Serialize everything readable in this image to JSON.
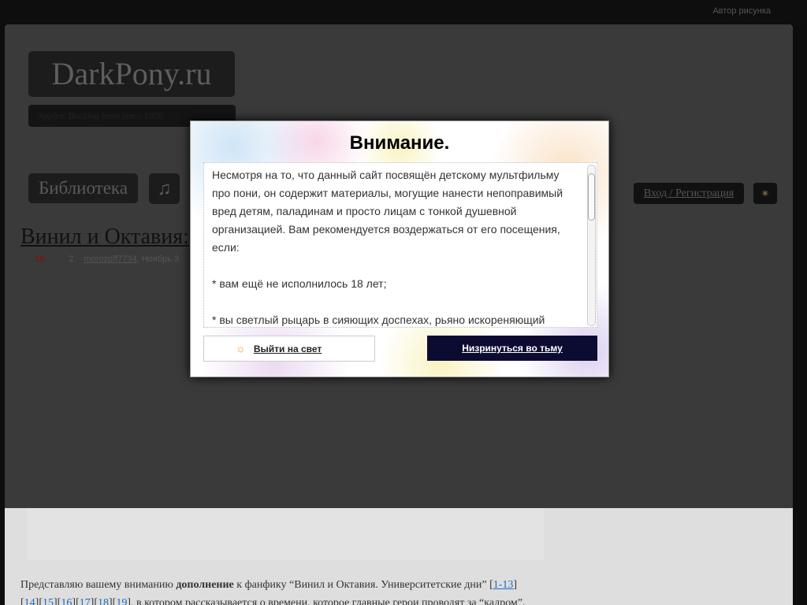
{
  "topbar": {
    "author_link": "Автор рисунка"
  },
  "header": {
    "logo": "DarkPony.ru",
    "tagline": "Apples. Bucking trees since 1976",
    "library": "Библиотека",
    "music_icon": "music-note-icon",
    "login": "Вход / Регистрация",
    "theme_icon": "sun-icon"
  },
  "post": {
    "title": "Винил и Октавия:",
    "age": "18",
    "comments": "2",
    "author": "morozoff7734",
    "date": "Ноябрь 3"
  },
  "intro": {
    "t1": "Представляю вашему вниманию ",
    "bold": "дополнение",
    "t2": " к фанфику “Винил и Октавия. Университетские дни” [",
    "l0": "1-13",
    "t3": "]",
    "l1": "14",
    "l2": "15",
    "l3": "16",
    "l4": "17",
    "l5": "18",
    "l6": "19",
    "t4": ", в котором рассказывается о времени, которое главные герои проводят за “кадром”."
  },
  "modal": {
    "title": "Внимание.",
    "p1": "Несмотря на то, что данный сайт посвящён детскому мультфильму про пони, он содержит материалы, могущие нанести непоправимый вред детям, паладинам и просто лицам с тонкой душевной организацией. Вам рекомендуется воздержаться от его посещения, если:",
    "p2": "* вам ещё не исполнилось 18 лет;",
    "p3": "* вы светлый рыцарь в сияющих доспехах, рьяно искореняющий",
    "light_button": "Выйти на свет",
    "dark_button": "Низринуться во тьму",
    "accent_dark": "#0c0c33"
  }
}
